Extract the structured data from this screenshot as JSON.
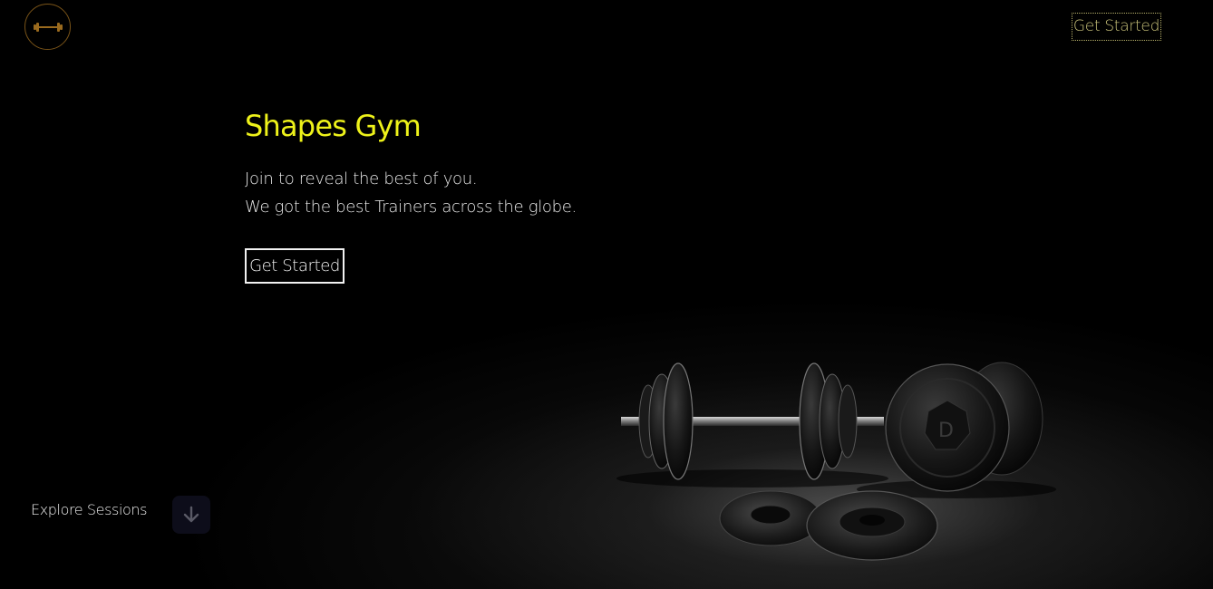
{
  "header": {
    "logo_icon": "dumbbell-icon",
    "cta_label": "Get Started"
  },
  "hero": {
    "title": "Shapes Gym",
    "line1": "Join to reveal the best of you.",
    "line2": "We got the best Trainers across the globe.",
    "cta_label": "Get Started"
  },
  "explore": {
    "label": "Explore Sessions",
    "icon": "arrow-down-icon"
  },
  "colors": {
    "accent_yellow": "#eef21a",
    "logo_brown": "#7a5418",
    "nav_cta_gold": "#c9c27a",
    "background": "#000000"
  }
}
